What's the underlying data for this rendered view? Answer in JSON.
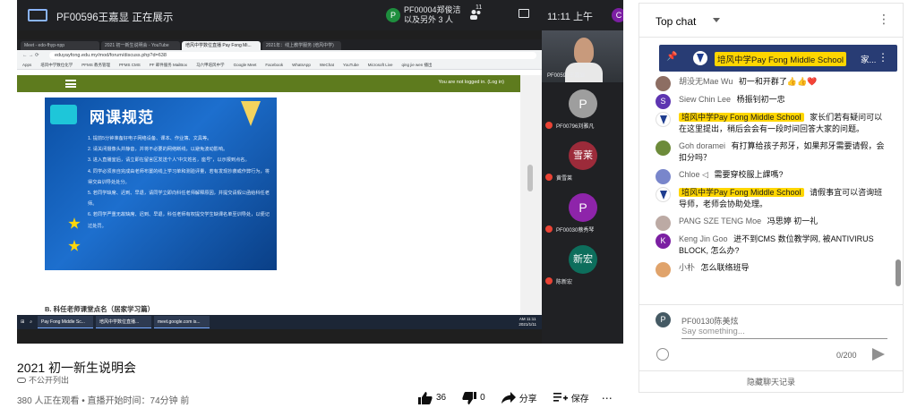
{
  "meet": {
    "presenting_text": "PF00596王嘉显 正在展示",
    "participant_avatar": "P",
    "participant_line1": "PF00004郑俊洁",
    "participant_line2": "以及另外 3 人",
    "people_count": "11",
    "clock": "11:11 上午",
    "user_avatar": "C",
    "more": "⋮"
  },
  "browser": {
    "tabs": [
      "Meet - edo-fhyp-npp",
      "2021 初一新生说明会 - YouTube",
      "培风中学数位直播 Pay Fong Mi...",
      "2021年：线上教学服务 (培风中学)"
    ],
    "url": "eduyayfong.edu.my/mod/forum/discuss.php?d=638",
    "bookmarks": [
      "Apps",
      "培风中学数位化学",
      "PFMS 教务管理",
      "PFMS CMS",
      "PF 邮件服务 MailBox",
      "马六甲培风中学",
      "Google Meet",
      "Facebook",
      "WhatsApp",
      "WeChat",
      "YouTube",
      "Microsoft Live",
      "qing jie wen 播出"
    ],
    "login_text": "You are not logged in. (Log in)",
    "section_heading": "B. 科任老师课堂点名（居家学习篇）"
  },
  "slide": {
    "title": "网课规范",
    "rules": [
      "1. 提前5分钟准备好电子网络设备、课本、作业簿、文具等。",
      "2. 请关闭摄像头并静音，并将不必要的网络断线，以避免波动影响。",
      "3. 进入直播室后，请立即在留言区发送个人\"中文姓名，座号\"，以示报到点名。",
      "4. 同学必须亲自完成由老师布置的线上学习单和测验评量，若有发现抄袭或作弊行为，将得交由训导处处分。",
      "5. 若同学缺席、迟到、早退，请同学立即向科任老师解释原因，并提交请假公函给科任老师。",
      "6. 若同学严重无故缺席、迟到、早退，科任老师有权提交学生缺课名单至训导处，以便记过处罚。"
    ]
  },
  "taskbar": {
    "search": "⌕",
    "apps": [
      "Pay Fong Middle Sc...",
      "培风中学数位直播...",
      "meet.google.com is..."
    ],
    "time": "AM 11:11",
    "date": "2021/1/11"
  },
  "tiles": [
    {
      "name": "PF00596王嘉显",
      "kind": "camera"
    },
    {
      "name": "PF00796刘雅凡",
      "initial": "P",
      "color": "#9e9e9e"
    },
    {
      "name": "黄雪莱",
      "initial": "雪莱",
      "color": "#9c2b3a"
    },
    {
      "name": "PF00030蔡秀琴",
      "initial": "P",
      "color": "#8e24aa"
    },
    {
      "name": "陈新宏",
      "initial": "新宏",
      "color": "#0d6e5c"
    }
  ],
  "video_info": {
    "title": "2021 初一新生说明会",
    "visibility": "不公开列出",
    "views": "380 人正在观看 • 直播开始时间：74分钟 前",
    "likes": "36",
    "dislikes": "0",
    "share": "分享",
    "save": "保存",
    "more": "⋯"
  },
  "chat": {
    "header": "Top chat",
    "pinned": {
      "author": "培风中学Pay Fong Middle School",
      "text": "家..."
    },
    "messages": [
      {
        "author": "胡没无Mae Wu",
        "text": "初一和开群了👍👍❤️",
        "av": "",
        "color": "#8d6e63",
        "owner": false
      },
      {
        "author": "Siew Chin Lee",
        "text": "杨振钊初一忠",
        "av": "S",
        "color": "#5e35b1",
        "owner": false
      },
      {
        "author": "培风中学Pay Fong Middle School",
        "text": "家长们若有疑问可以在这里提出，稍后会会有一段时间回答大家的问题。",
        "av": "",
        "color": "",
        "owner": true
      },
      {
        "author": "Goh doramei",
        "text": "有打算给孩子邦牙，如果邦牙需要请假，会扣分吗？",
        "av": "",
        "color": "#6d8b3a",
        "owner": false
      },
      {
        "author": "Chloe ◁",
        "text": "需要穿校服上課嗎?",
        "av": "",
        "color": "#7986cb",
        "owner": false
      },
      {
        "author": "培风中学Pay Fong Middle School",
        "text": "请假事宜可以咨询班导师，老师会协助处理。",
        "av": "",
        "color": "",
        "owner": true
      },
      {
        "author": "PANG SZE TENG Moe",
        "text": "冯思婷 初一礼",
        "av": "",
        "color": "#bcaaa4",
        "owner": false
      },
      {
        "author": "Keng Jin Goo",
        "text": "进不到CMS 数位教学网, 被ANTIVIRUS BLOCK, 怎么办?",
        "av": "K",
        "color": "#7b1fa2",
        "owner": false
      },
      {
        "author": "小朴",
        "text": "怎么联络班导",
        "av": "",
        "color": "#e0a36b",
        "owner": false
      }
    ],
    "composer": {
      "avatar": "P",
      "name": "PF00130陈美炫",
      "placeholder": "Say something...",
      "counter": "0/200"
    },
    "hide_chat": "隐藏聊天记录"
  },
  "colors": {
    "pinned_bg": "#283c74",
    "owner_badge": "#ffd600",
    "moodle_bar": "#5e7b1e"
  }
}
